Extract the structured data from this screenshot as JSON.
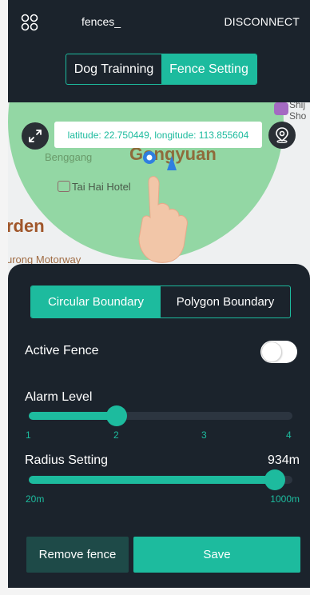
{
  "header": {
    "device_name": "fences_",
    "disconnect_label": "DISCONNECT",
    "tabs": [
      {
        "label": "Dog Trainning",
        "active": false
      },
      {
        "label": "Fence Setting",
        "active": true
      }
    ]
  },
  "map": {
    "coordinates_text": "latitude: 22.750449, longitude: 113.855604",
    "labels": {
      "benggang": "Benggang",
      "guangyuan": "Gongyuan",
      "tai_hai_hotel": "Tai Hai Hotel",
      "rden": "rden",
      "motorway": "urong Motorway",
      "shij_line1": "Shij",
      "shij_line2": "Sho"
    }
  },
  "panel": {
    "boundary_options": [
      {
        "label": "Circular Boundary",
        "active": true
      },
      {
        "label": "Polygon Boundary",
        "active": false
      }
    ],
    "active_fence": {
      "label": "Active Fence",
      "enabled": false
    },
    "alarm_level": {
      "label": "Alarm Level",
      "value": 2,
      "min": 1,
      "max": 4,
      "ticks": [
        "1",
        "2",
        "3",
        "4"
      ]
    },
    "radius": {
      "label": "Radius Setting",
      "value_text": "934m",
      "value": 934,
      "min_label": "20m",
      "max_label": "1000m",
      "min": 20,
      "max": 1000
    },
    "remove_label": "Remove fence",
    "save_label": "Save"
  },
  "colors": {
    "accent": "#1dbb9e",
    "background": "#1b232c",
    "remove_button": "#1e4a48"
  }
}
